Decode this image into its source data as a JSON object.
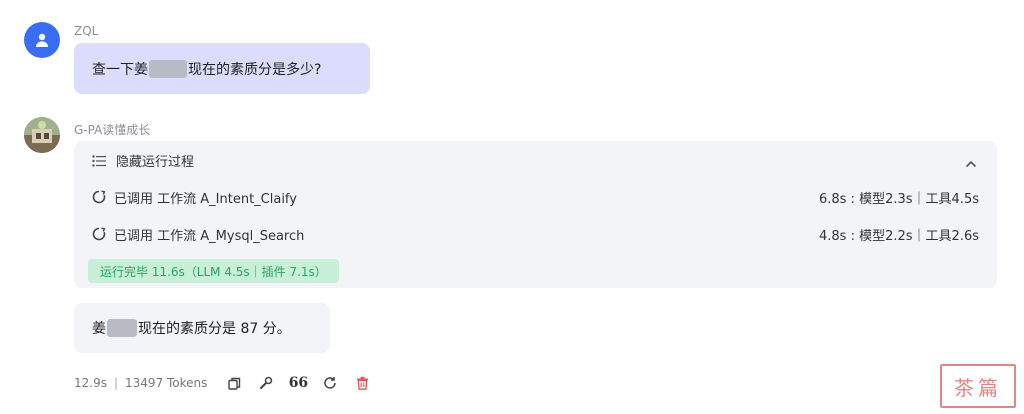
{
  "user_message": {
    "name": "ZQL",
    "text_prefix": "查一下姜",
    "text_suffix": "现在的素质分是多少?"
  },
  "bot": {
    "name": "G-PA读懂成长",
    "process": {
      "toggle_label": "隐藏运行过程",
      "calls": [
        {
          "label": "已调用 工作流 A_Intent_Claify",
          "timing": "6.8s : 模型2.3s｜工具4.5s"
        },
        {
          "label": "已调用 工作流 A_Mysql_Search",
          "timing": "4.8s : 模型2.2s｜工具2.6s"
        }
      ],
      "summary": "运行完毕 11.6s（LLM 4.5s｜插件 7.1s）"
    },
    "answer": {
      "text_prefix": "姜",
      "text_suffix": "现在的素质分是 87 分。"
    },
    "footer": {
      "duration": "12.9s",
      "tokens": "13497 Tokens",
      "quote_label": "66"
    }
  },
  "watermark_text": "茶篇",
  "icons": {
    "user_avatar": "person-icon",
    "bot_avatar": "bot-avatar-image",
    "list": "list-icon",
    "collapse": "chevron-up-icon",
    "workflow": "workflow-icon",
    "copy": "copy-icon",
    "tool": "wrench-icon",
    "quote": "quote-icon",
    "regenerate": "refresh-icon",
    "delete": "trash-icon"
  },
  "colors": {
    "user_avatar_bg": "#3b6cf6",
    "user_bubble_bg": "#dcdcff",
    "panel_bg": "#f3f4f7",
    "success_bg": "#c8efd8",
    "success_text": "#2aa55f",
    "delete_icon": "#e05252"
  }
}
